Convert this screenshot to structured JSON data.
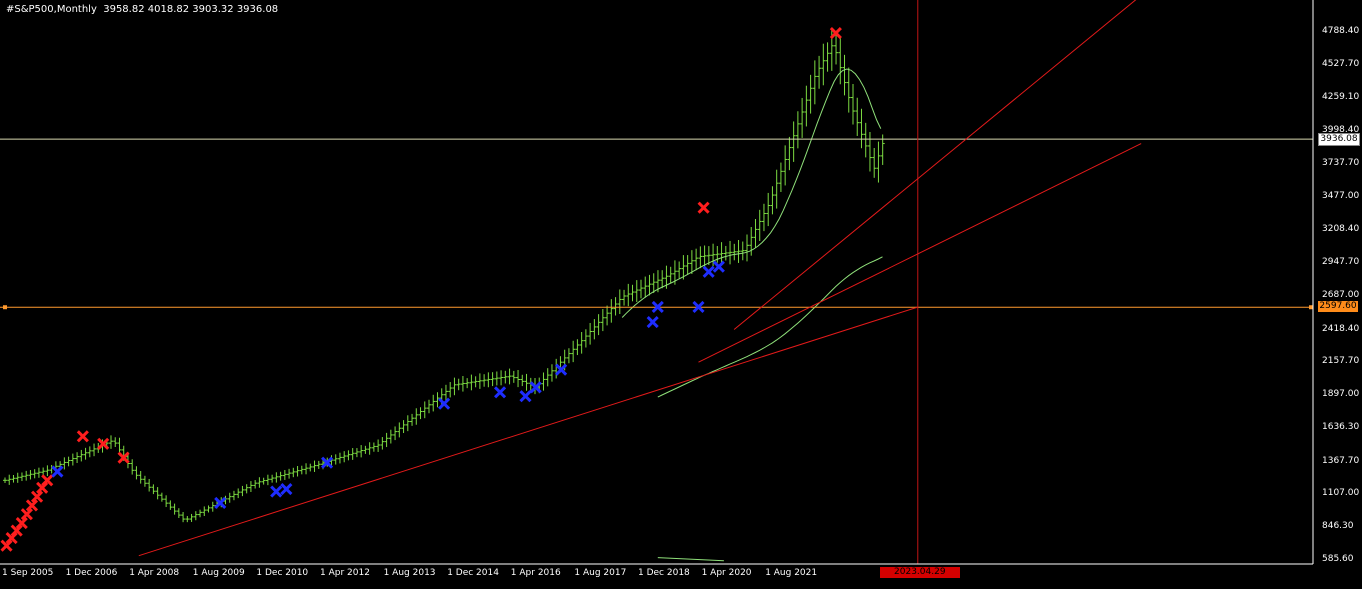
{
  "header": {
    "symbol": "#S&P500,Monthly",
    "ohlc": "3958.82 4018.82 3903.32 3936.08"
  },
  "colors": {
    "background": "#000000",
    "bars": "#7ddc42",
    "ma_line": "#8fe07a",
    "trendline": "#e21a1a",
    "crosshair": "#c21515",
    "current_price_line": "#d9d9b0",
    "level_line": "#ff9a2e",
    "buy_marker": "#1e2dff",
    "sell_marker": "#ff1e1e",
    "axis_text": "#ffffff"
  },
  "chart_data": {
    "type": "candlestick",
    "timeframe": "Monthly",
    "y_ticks": [
      "4788.40",
      "4527.70",
      "4259.10",
      "3998.40",
      "3737.70",
      "3477.00",
      "3208.40",
      "2947.70",
      "2687.00",
      "2418.40",
      "2157.70",
      "1897.00",
      "1636.30",
      "1367.70",
      "1107.00",
      "846.30",
      "585.60"
    ],
    "x_ticks": [
      "1 Sep 2005",
      "1 Dec 2006",
      "1 Apr 2008",
      "1 Aug 2009",
      "1 Dec 2010",
      "1 Apr 2012",
      "1 Aug 2013",
      "1 Dec 2014",
      "1 Apr 2016",
      "1 Aug 2017",
      "1 Dec 2018",
      "1 Apr 2020",
      "1 Aug 2021"
    ],
    "ylim": [
      585.6,
      4950
    ],
    "current_price": "3936.08",
    "level_price": "2597.60",
    "crosshair_date": "2023.04.29 00:00",
    "anchor_years": [
      2005.67,
      2006.5,
      2007.8,
      2008.2,
      2009.2,
      2010.6,
      2011.7,
      2013.0,
      2014.5,
      2015.6,
      2016.1,
      2017.0,
      2017.8,
      2018.7,
      2019.3,
      2020.2,
      2020.7,
      2021.6,
      2021.95,
      2022.3,
      2022.75,
      2022.95
    ],
    "anchor_prices": [
      1220,
      1300,
      1540,
      1280,
      900,
      1200,
      1330,
      1500,
      1980,
      2050,
      1960,
      2330,
      2680,
      2850,
      3000,
      3050,
      3430,
      4450,
      4700,
      4200,
      3700,
      3936
    ],
    "sell_signals": [
      {
        "year": 2005.7,
        "price": 700
      },
      {
        "year": 2005.8,
        "price": 760
      },
      {
        "year": 2005.9,
        "price": 820
      },
      {
        "year": 2006.0,
        "price": 880
      },
      {
        "year": 2006.1,
        "price": 950
      },
      {
        "year": 2006.2,
        "price": 1020
      },
      {
        "year": 2006.3,
        "price": 1090
      },
      {
        "year": 2006.4,
        "price": 1160
      },
      {
        "year": 2006.5,
        "price": 1220
      },
      {
        "year": 2007.2,
        "price": 1570
      },
      {
        "year": 2007.6,
        "price": 1510
      },
      {
        "year": 2008.0,
        "price": 1400
      },
      {
        "year": 2019.4,
        "price": 3390
      },
      {
        "year": 2022.0,
        "price": 4780
      }
    ],
    "buy_signals": [
      {
        "year": 2006.7,
        "price": 1290
      },
      {
        "year": 2009.9,
        "price": 1040
      },
      {
        "year": 2011.0,
        "price": 1130
      },
      {
        "year": 2011.2,
        "price": 1150
      },
      {
        "year": 2012.0,
        "price": 1360
      },
      {
        "year": 2014.3,
        "price": 1830
      },
      {
        "year": 2015.4,
        "price": 1920
      },
      {
        "year": 2015.9,
        "price": 1890
      },
      {
        "year": 2016.1,
        "price": 1960
      },
      {
        "year": 2016.6,
        "price": 2100
      },
      {
        "year": 2018.4,
        "price": 2480
      },
      {
        "year": 2018.5,
        "price": 2600
      },
      {
        "year": 2019.3,
        "price": 2600
      },
      {
        "year": 2019.5,
        "price": 2880
      },
      {
        "year": 2019.7,
        "price": 2920
      }
    ],
    "trendlines": [
      {
        "from": {
          "year": 2008.3,
          "price": 620
        },
        "to": {
          "year": 2023.6,
          "price": 2597.6
        }
      },
      {
        "from": {
          "year": 2019.3,
          "price": 2160
        },
        "to": {
          "year": 2028.0,
          "price": 3900
        }
      },
      {
        "from": {
          "year": 2020.0,
          "price": 2420
        },
        "to": {
          "year": 2028.0,
          "price": 5080
        }
      }
    ]
  }
}
